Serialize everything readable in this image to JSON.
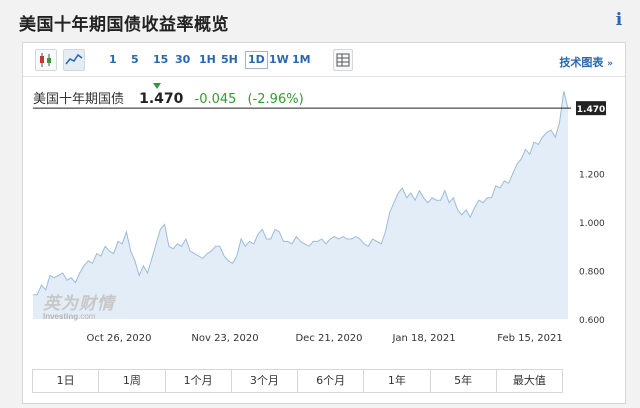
{
  "header": {
    "title": "美国十年期国债收益率概览",
    "info_icon": "info-icon"
  },
  "toolbar": {
    "periods": [
      "1",
      "5",
      "15",
      "30",
      "1H",
      "5H",
      "1D",
      "1W",
      "1M"
    ],
    "active_period": "1D",
    "tech_label": "技术图表",
    "tech_chevron": "»",
    "icons": [
      "candlestick-icon",
      "line-chart-icon",
      "table-icon"
    ]
  },
  "quote": {
    "name": "美国十年期国债",
    "last": "1.470",
    "change": "-0.045",
    "change_pct": "(-2.96%)",
    "color_down": "#2f9e2f"
  },
  "watermark": {
    "cn": "英为财情",
    "en": "Investing",
    "en_suffix": ".com"
  },
  "ranges": [
    "1日",
    "1周",
    "1个月",
    "3个月",
    "6个月",
    "1年",
    "5年",
    "最大值"
  ],
  "chart_data": {
    "type": "area",
    "title": "",
    "xlabel": "",
    "ylabel": "",
    "x_ticks": [
      "Oct 26, 2020",
      "Nov 23, 2020",
      "Dec 21, 2020",
      "Jan 18, 2021",
      "Feb 15, 2021"
    ],
    "y_ticks": [
      "0.600",
      "0.800",
      "1.000",
      "1.200"
    ],
    "ylim": [
      0.6,
      1.45
    ],
    "current_value_label": "1.470",
    "current_value": 1.47,
    "grid": false,
    "color": "#9bbbd9",
    "fill": "#e3edf7",
    "series": [
      {
        "values": [
          0.7,
          0.7,
          0.74,
          0.72,
          0.78,
          0.77,
          0.78,
          0.79,
          0.76,
          0.77,
          0.75,
          0.79,
          0.82,
          0.84,
          0.83,
          0.87,
          0.86,
          0.9,
          0.88,
          0.87,
          0.92,
          0.91,
          0.96,
          0.88,
          0.84,
          0.78,
          0.82,
          0.79,
          0.85,
          0.91,
          0.97,
          0.99,
          0.9,
          0.89,
          0.91,
          0.9,
          0.93,
          0.88,
          0.87,
          0.86,
          0.85,
          0.87,
          0.88,
          0.9,
          0.9,
          0.86,
          0.84,
          0.83,
          0.86,
          0.93,
          0.9,
          0.92,
          0.91,
          0.95,
          0.97,
          0.93,
          0.93,
          0.97,
          0.96,
          0.92,
          0.92,
          0.91,
          0.94,
          0.92,
          0.91,
          0.9,
          0.92,
          0.92,
          0.93,
          0.91,
          0.93,
          0.94,
          0.93,
          0.94,
          0.93,
          0.93,
          0.94,
          0.93,
          0.91,
          0.9,
          0.93,
          0.92,
          0.91,
          0.96,
          1.04,
          1.08,
          1.12,
          1.14,
          1.1,
          1.12,
          1.09,
          1.13,
          1.1,
          1.08,
          1.1,
          1.09,
          1.09,
          1.13,
          1.08,
          1.1,
          1.05,
          1.03,
          1.05,
          1.02,
          1.06,
          1.09,
          1.08,
          1.1,
          1.1,
          1.15,
          1.14,
          1.17,
          1.16,
          1.2,
          1.24,
          1.26,
          1.3,
          1.28,
          1.33,
          1.32,
          1.35,
          1.37,
          1.38,
          1.35,
          1.41,
          1.54,
          1.47
        ]
      }
    ]
  }
}
